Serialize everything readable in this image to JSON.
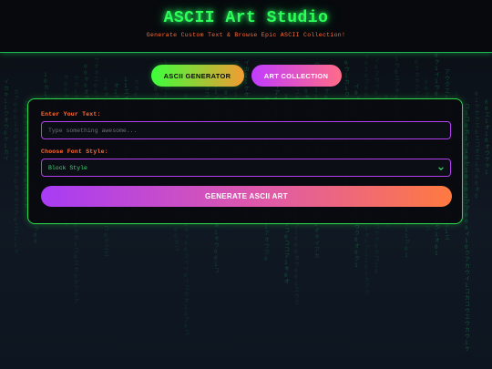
{
  "header": {
    "title": "ASCII Art Studio",
    "subtitle": "Generate Custom Text & Browse Epic ASCII Collection!"
  },
  "nav": {
    "generator_label": "ASCII GENERATOR",
    "collection_label": "ART COLLECTION"
  },
  "form": {
    "text_label": "Enter Your Text:",
    "text_placeholder": "Type something awesome...",
    "text_value": "",
    "font_label": "Choose Font Style:",
    "font_selected": "Block Style",
    "generate_label": "GENERATE ASCII ART"
  },
  "colors": {
    "accent_green": "#2bff5a",
    "accent_orange": "#ff6b35",
    "accent_purple": "#b43ef0",
    "background": "#0a0e14"
  },
  "icons": {
    "select_chevron": "chevron-down-icon"
  }
}
